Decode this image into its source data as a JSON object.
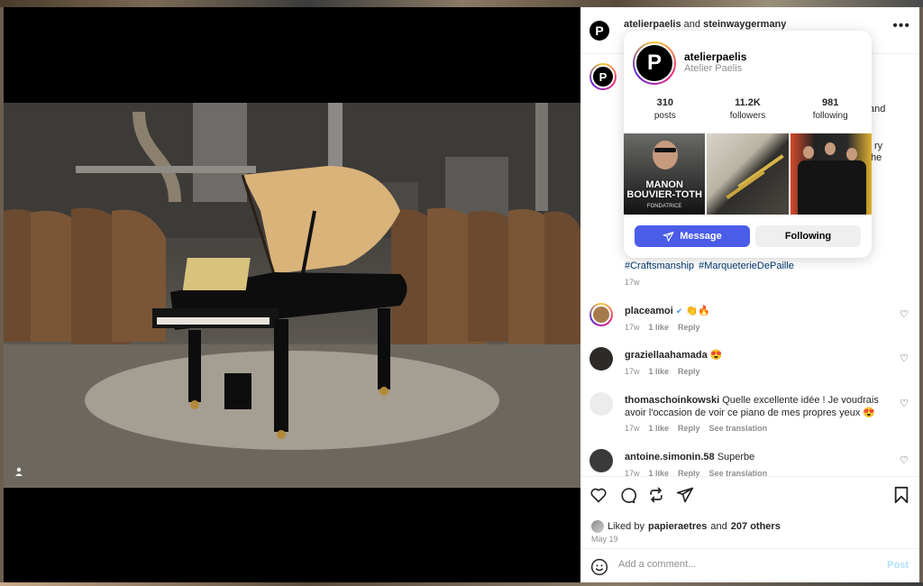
{
  "post_header": {
    "author": "atelierpaelis",
    "joiner": "and",
    "collaborator": "steinwaygermany"
  },
  "caption": {
    "fragment_1": "and",
    "fragment_2": "ry",
    "fragment_3": "he",
    "hashtags": [
      "#Craftsmanship",
      "#MarqueterieDePaille"
    ],
    "time": "17w"
  },
  "profile_card": {
    "username": "atelierpaelis",
    "full_name": "Atelier Paelis",
    "stats": [
      {
        "value": "310",
        "label": "posts"
      },
      {
        "value": "11.2K",
        "label": "followers"
      },
      {
        "value": "981",
        "label": "following"
      }
    ],
    "thumb_1_text": "MANON BOUVIER-TOTH",
    "thumb_1_subtext": "FONDATRICE",
    "message_label": "Message",
    "following_label": "Following"
  },
  "comments": [
    {
      "user": "placeamoi",
      "text": "👏🔥",
      "time": "17w",
      "likes": "1 like",
      "reply": "Reply",
      "translation": ""
    },
    {
      "user": "graziellaahamada",
      "text": "😍",
      "time": "17w",
      "likes": "1 like",
      "reply": "Reply",
      "translation": ""
    },
    {
      "user": "thomaschoinkowski",
      "text": "Quelle excellente idée ! Je voudrais avoir l'occasion de voir ce piano de mes propres yeux 😍",
      "time": "17w",
      "likes": "1 like",
      "reply": "Reply",
      "translation": "See translation"
    },
    {
      "user": "antoine.simonin.58",
      "text": "Superbe",
      "time": "17w",
      "likes": "1 like",
      "reply": "Reply",
      "translation": "See translation"
    }
  ],
  "likes": {
    "prefix": "Liked by",
    "user": "papieraetres",
    "joiner": "and",
    "others": "207 others"
  },
  "date": "May 19",
  "add_comment": {
    "placeholder": "Add a comment...",
    "post_label": "Post"
  },
  "icons": {
    "heart": "heart-icon",
    "comment": "comment-icon",
    "repost": "repost-icon",
    "share": "share-icon",
    "save": "bookmark-icon",
    "emoji": "emoji-icon",
    "more": "more-icon"
  },
  "colors": {
    "primary_button": "#4a5ce8",
    "link": "#00376b",
    "muted": "#8e8e8e"
  }
}
